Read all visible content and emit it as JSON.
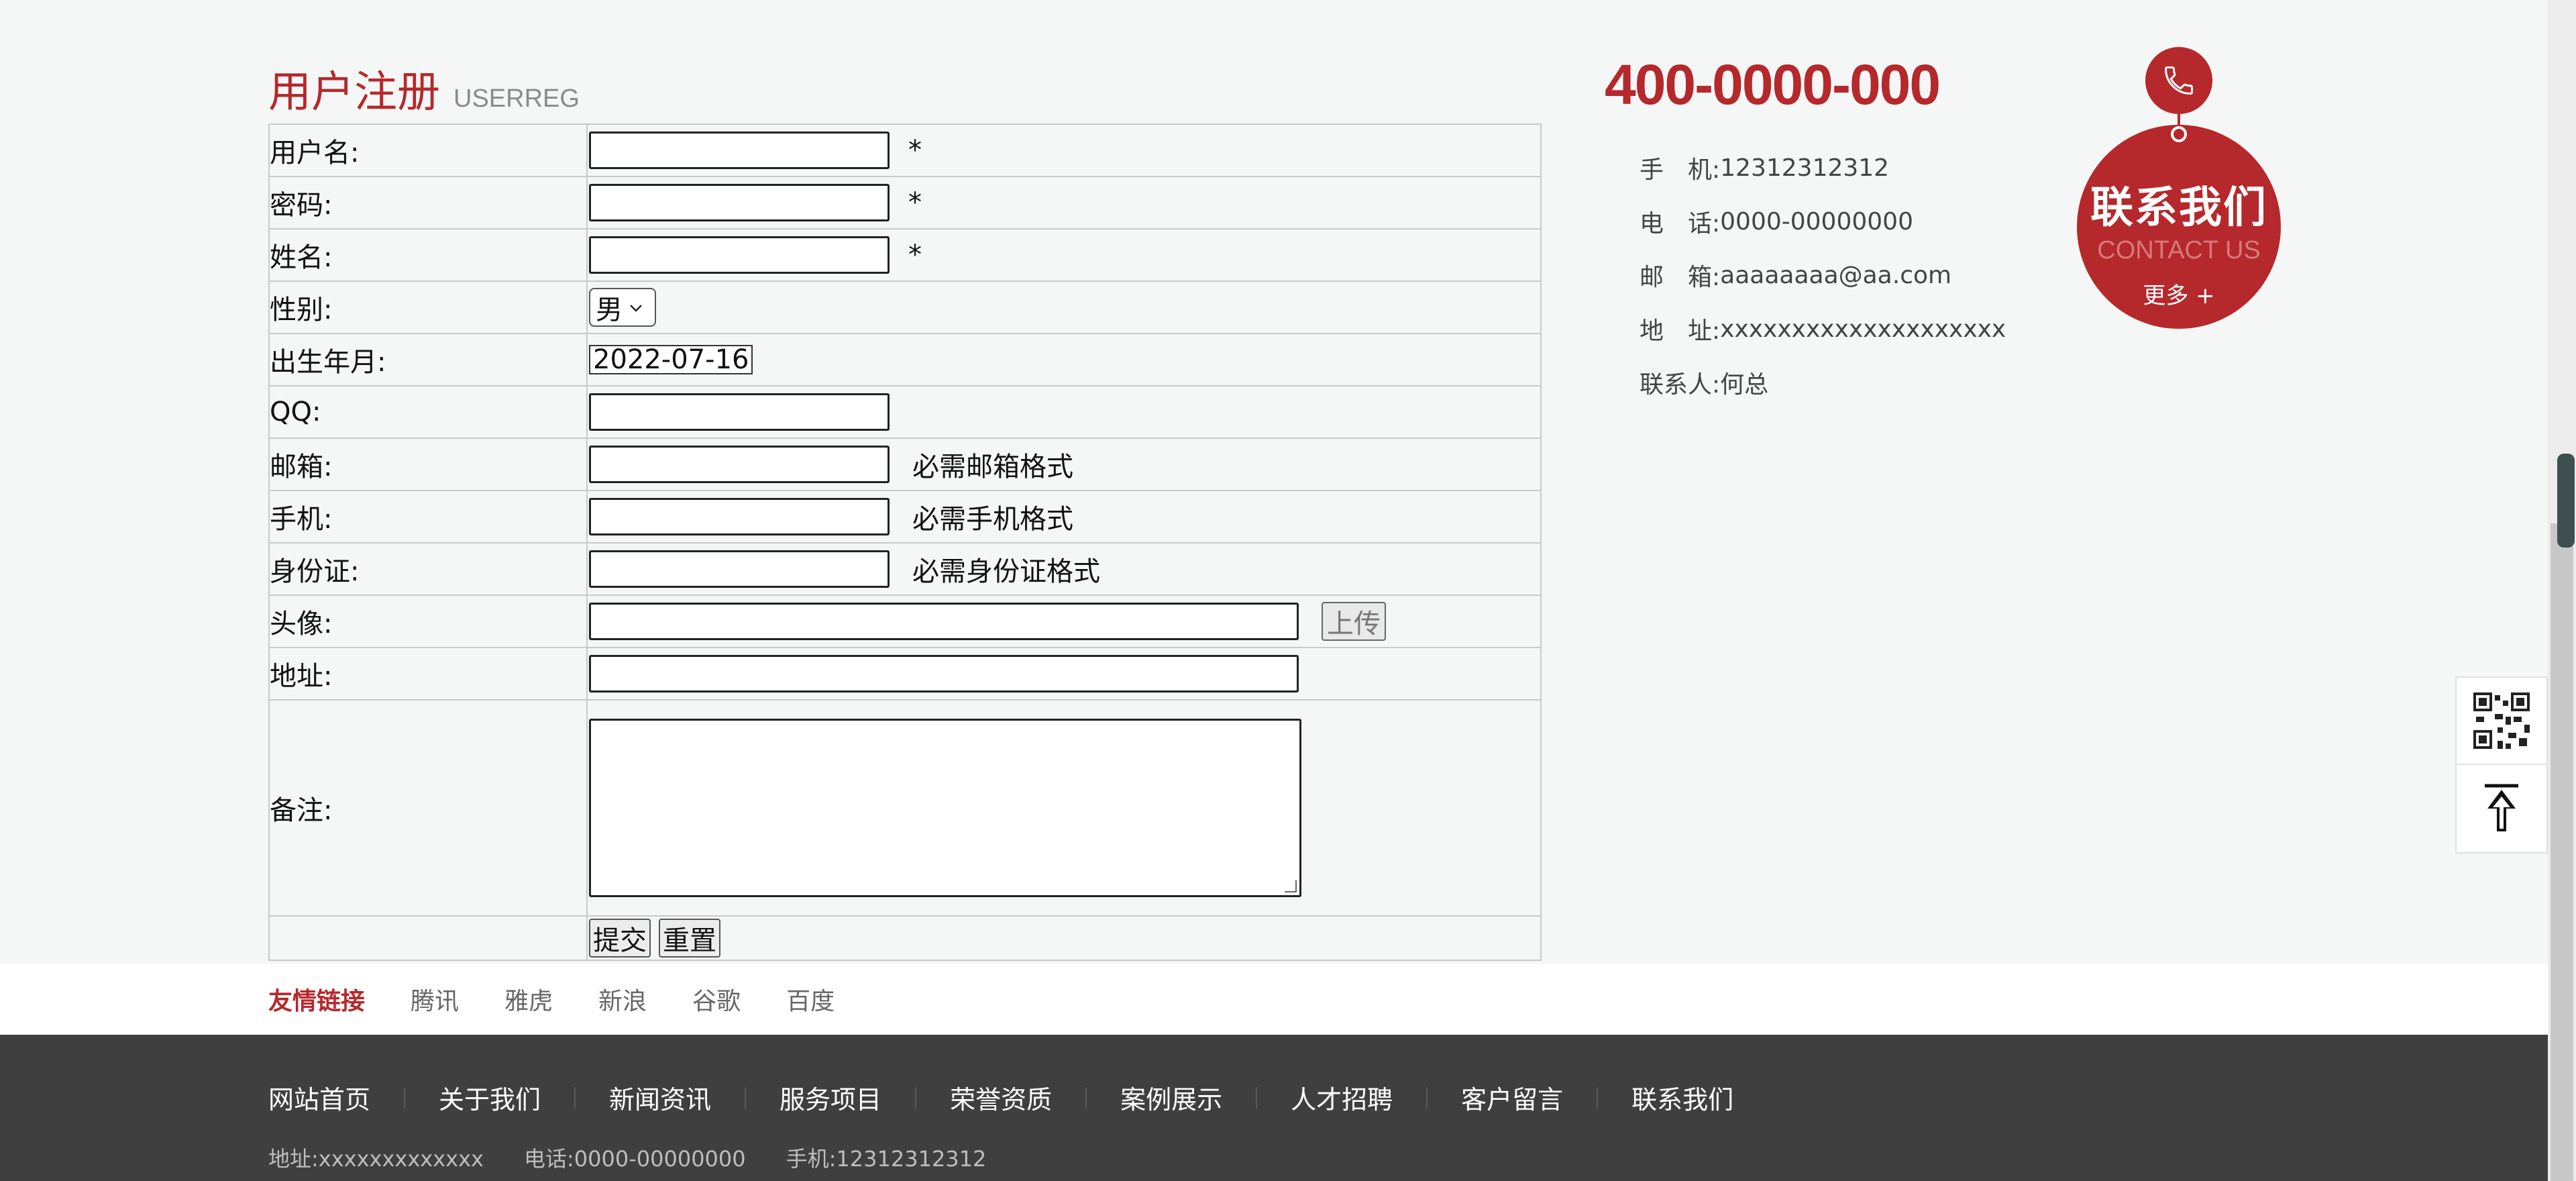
{
  "register": {
    "title_cn": "用户注册",
    "title_en": "USERREG",
    "fields": {
      "username": {
        "label": "用户名:",
        "mark": "*"
      },
      "password": {
        "label": "密码:",
        "mark": "*"
      },
      "name": {
        "label": "姓名:",
        "mark": "*"
      },
      "gender": {
        "label": "性别:",
        "value": "男"
      },
      "birth": {
        "label": "出生年月:",
        "value": "2022-07-16"
      },
      "qq": {
        "label": "QQ:"
      },
      "email": {
        "label": "邮箱:",
        "hint": "必需邮箱格式"
      },
      "mobile": {
        "label": "手机:",
        "hint": "必需手机格式"
      },
      "idcard": {
        "label": "身份证:",
        "hint": "必需身份证格式"
      },
      "avatar": {
        "label": "头像:",
        "upload": "上传"
      },
      "address": {
        "label": "地址:"
      },
      "remark": {
        "label": "备注:"
      }
    },
    "submit": "提交",
    "reset": "重置"
  },
  "contact": {
    "hotline": "400-0000-000",
    "items": [
      {
        "key": "手　机:",
        "value": "12312312312"
      },
      {
        "key": "电　话:",
        "value": "0000-00000000"
      },
      {
        "key": "邮　箱:",
        "value": "aaaaaaaa@aa.com"
      },
      {
        "key": "地　址:",
        "value": "xxxxxxxxxxxxxxxxxxxx"
      },
      {
        "key": "联系人:",
        "value": "何总"
      }
    ],
    "badge": {
      "cn": "联系我们",
      "en": "CONTACT US",
      "more": "更多 +"
    }
  },
  "friend_links": {
    "title": "友情链接",
    "items": [
      "腾讯",
      "雅虎",
      "新浪",
      "谷歌",
      "百度"
    ]
  },
  "footer": {
    "nav": [
      "网站首页",
      "关于我们",
      "新闻资讯",
      "服务项目",
      "荣誉资质",
      "案例展示",
      "人才招聘",
      "客户留言",
      "联系我们"
    ],
    "address": "地址:xxxxxxxxxxxxx",
    "phone": "电话:0000-00000000",
    "mobile": "手机:12312312312"
  },
  "colors": {
    "accent": "#b5282c",
    "footer_bg": "#3f3f3f",
    "page_bg": "#f5f7f6"
  },
  "icons": {
    "badge_pin": "phone-icon",
    "float_qr": "qr-code-icon",
    "float_top": "back-to-top-icon"
  }
}
